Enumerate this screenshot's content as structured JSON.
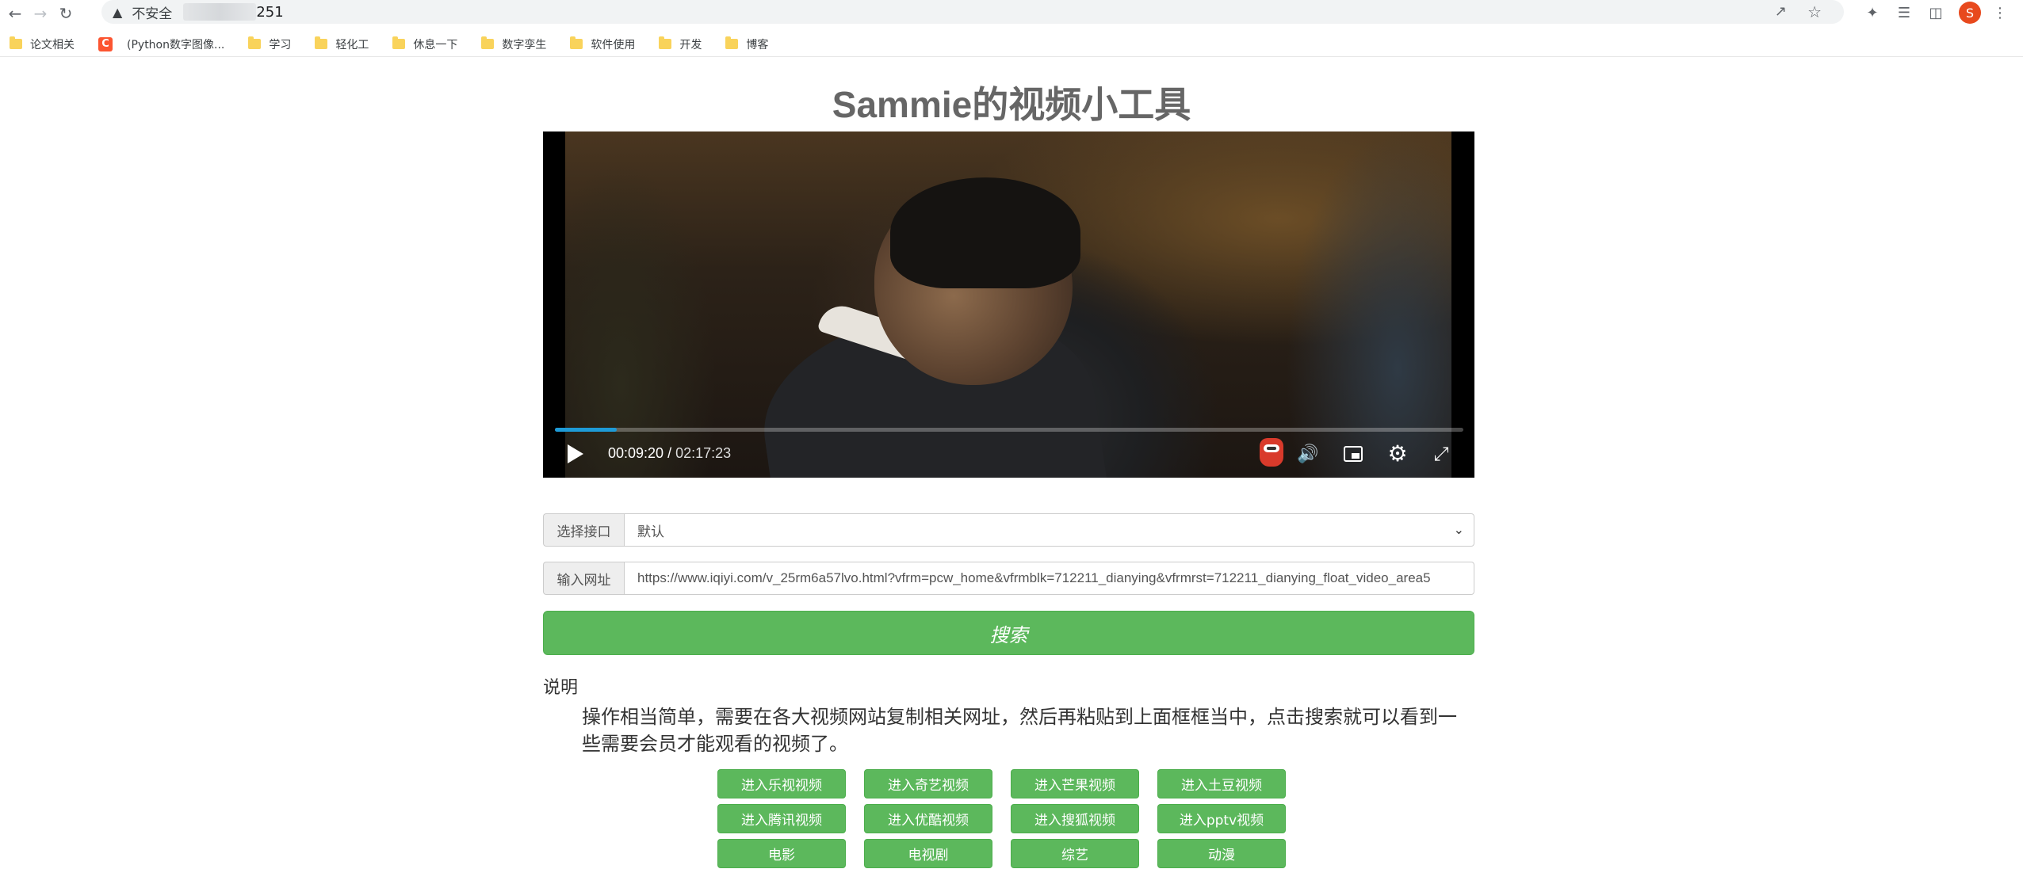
{
  "browser": {
    "url_security_label": "不安全",
    "url_tail": "251",
    "profile_initial": "S",
    "bookmarks": [
      {
        "label": "论文相关",
        "type": "folder"
      },
      {
        "label": "(Python数字图像...",
        "type": "csdn"
      },
      {
        "label": "学习",
        "type": "folder"
      },
      {
        "label": "轻化工",
        "type": "folder"
      },
      {
        "label": "休息一下",
        "type": "folder"
      },
      {
        "label": "数字孪生",
        "type": "folder"
      },
      {
        "label": "软件使用",
        "type": "folder"
      },
      {
        "label": "开发",
        "type": "folder"
      },
      {
        "label": "博客",
        "type": "folder"
      }
    ],
    "csdn_glyph": "C"
  },
  "page": {
    "title": "Sammie的视频小工具"
  },
  "player": {
    "current_time": "00:09:20",
    "separator": "/",
    "duration": "02:17:23",
    "progress_fraction": 0.068,
    "accent_color": "#1e9bd7"
  },
  "form": {
    "api_label": "选择接口",
    "api_selected": "默认",
    "url_label": "输入网址",
    "url_value": "https://www.iqiyi.com/v_25rm6a57lvo.html?vfrm=pcw_home&vfrmblk=712211_dianying&vfrmrst=712211_dianying_float_video_area5",
    "search_label": "搜索",
    "button_color": "#5cb85c"
  },
  "description": {
    "title": "说明",
    "text": "操作相当简单，需要在各大视频网站复制相关网址，然后再粘贴到上面框框当中，点击搜索就可以看到一些需要会员才能观看的视频了。"
  },
  "links": [
    "进入乐视视频",
    "进入奇艺视频",
    "进入芒果视频",
    "进入土豆视频",
    "进入腾讯视频",
    "进入优酷视频",
    "进入搜狐视频",
    "进入pptv视频",
    "电影",
    "电视剧",
    "综艺",
    "动漫"
  ]
}
